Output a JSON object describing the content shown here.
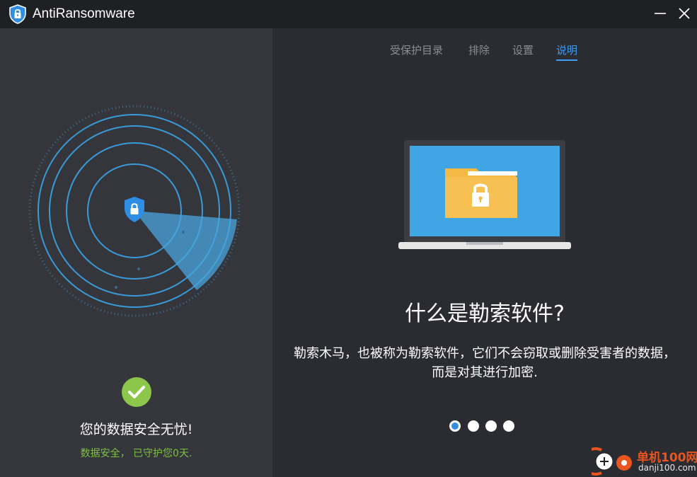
{
  "app": {
    "title": "AntiRansomware",
    "logo_icon": "shield-lock-icon",
    "minimize_icon": "minimize-icon",
    "close_icon": "close-icon"
  },
  "left": {
    "status_icon": "check-circle-icon",
    "status_title": "您的数据安全无忧!",
    "status_sub": "数据安全， 已守护您0天."
  },
  "tabs": [
    {
      "label": "受保护目录",
      "active": false
    },
    {
      "label": "排除",
      "active": false
    },
    {
      "label": "设置",
      "active": false
    },
    {
      "label": "说明",
      "active": true
    }
  ],
  "main": {
    "illustration": "laptop-locked-folder",
    "heading": "什么是勒索软件?",
    "description": "勒索木马，也被称为勒索软件，它们不会窃取或删除受害者的数据，而是对其进行加密.",
    "pager": {
      "total": 4,
      "current": 1
    }
  },
  "watermark": {
    "cn": "单机100网",
    "en": "danji100.com"
  },
  "colors": {
    "accent": "#3d9df5",
    "ok_green": "#7cc243",
    "titlebar_bg": "#1f2024",
    "left_bg": "#35363c",
    "right_bg": "#2b2c31",
    "screen_blue": "#3fa5e4",
    "folder_yellow": "#f7c052"
  }
}
